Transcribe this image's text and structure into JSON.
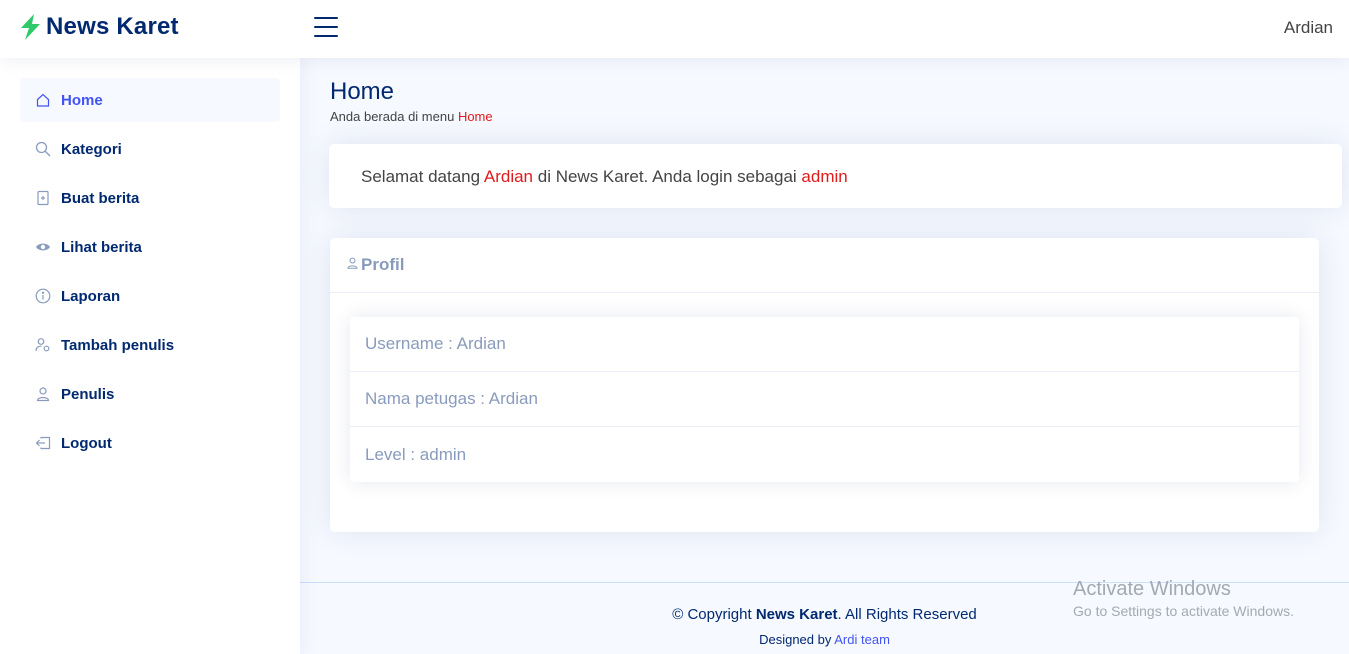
{
  "header": {
    "brand": "News Karet",
    "user_name": "Ardian",
    "brand_color": "#012970",
    "logo_color": "#2eca6a"
  },
  "sidebar": {
    "items": [
      {
        "label": "Home",
        "icon": "house-icon",
        "active": true
      },
      {
        "label": "Kategori",
        "icon": "search-icon"
      },
      {
        "label": "Buat berita",
        "icon": "file-plus-icon"
      },
      {
        "label": "Lihat berita",
        "icon": "eye-icon"
      },
      {
        "label": "Laporan",
        "icon": "info-circle-icon"
      },
      {
        "label": "Tambah penulis",
        "icon": "person-gear-icon"
      },
      {
        "label": "Penulis",
        "icon": "person-icon"
      },
      {
        "label": "Logout",
        "icon": "box-arrow-left-icon"
      }
    ]
  },
  "page": {
    "title": "Home",
    "breadcrumb_prefix": "Anda berada di menu ",
    "breadcrumb_current": "Home"
  },
  "welcome": {
    "prefix": "Selamat datang ",
    "user": "Ardian",
    "middle": " di News Karet. Anda login sebagai ",
    "level": "admin",
    "highlight_color": "#e01b1b"
  },
  "profile": {
    "title": "Profil",
    "items": [
      "Username : Ardian",
      "Nama petugas : Ardian",
      "Level : admin"
    ]
  },
  "footer": {
    "copyright_prefix": "© Copyright ",
    "copyright_brand": "News Karet",
    "copyright_suffix": ". All Rights Reserved",
    "designed_prefix": "Designed by ",
    "designed_link": "Ardi team"
  },
  "watermark": {
    "title": "Activate Windows",
    "subtitle": "Go to Settings to activate Windows."
  }
}
